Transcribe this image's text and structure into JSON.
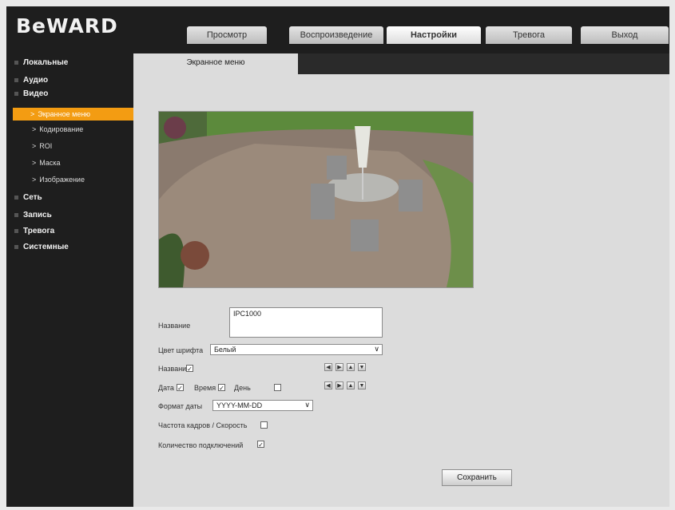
{
  "brand": "BeWARD",
  "nav": [
    "Просмотр",
    "Воспроизведение",
    "Настройки",
    "Тревога",
    "Выход"
  ],
  "sidebar": {
    "items": [
      "Локальные",
      "Аудио",
      "Видео",
      "Сеть",
      "Запись",
      "Тревога",
      "Системные"
    ],
    "video_sub": [
      "Экранное меню",
      "Кодирование",
      "ROI",
      "Маска",
      "Изображение"
    ],
    "sub_arrow": ">"
  },
  "tab": "Экранное меню",
  "form": {
    "name_label": "Название",
    "name_value": "IPC1000",
    "font_color_label": "Цвет шрифта",
    "font_color_value": "Белый",
    "name_check_label": "Название",
    "date_label": "Дата",
    "time_label": "Время",
    "day_label": "День",
    "date_format_label": "Формат даты",
    "date_format_value": "YYYY-MM-DD",
    "fps_label": "Частота кадров / Скорость",
    "connections_label": "Количество подключений",
    "check_mark": "✓",
    "pos_buttons": [
      "◀",
      "▶",
      "▲",
      "▼"
    ],
    "save_label": "Сохранить"
  },
  "colors": {
    "accent": "#f39c12"
  }
}
